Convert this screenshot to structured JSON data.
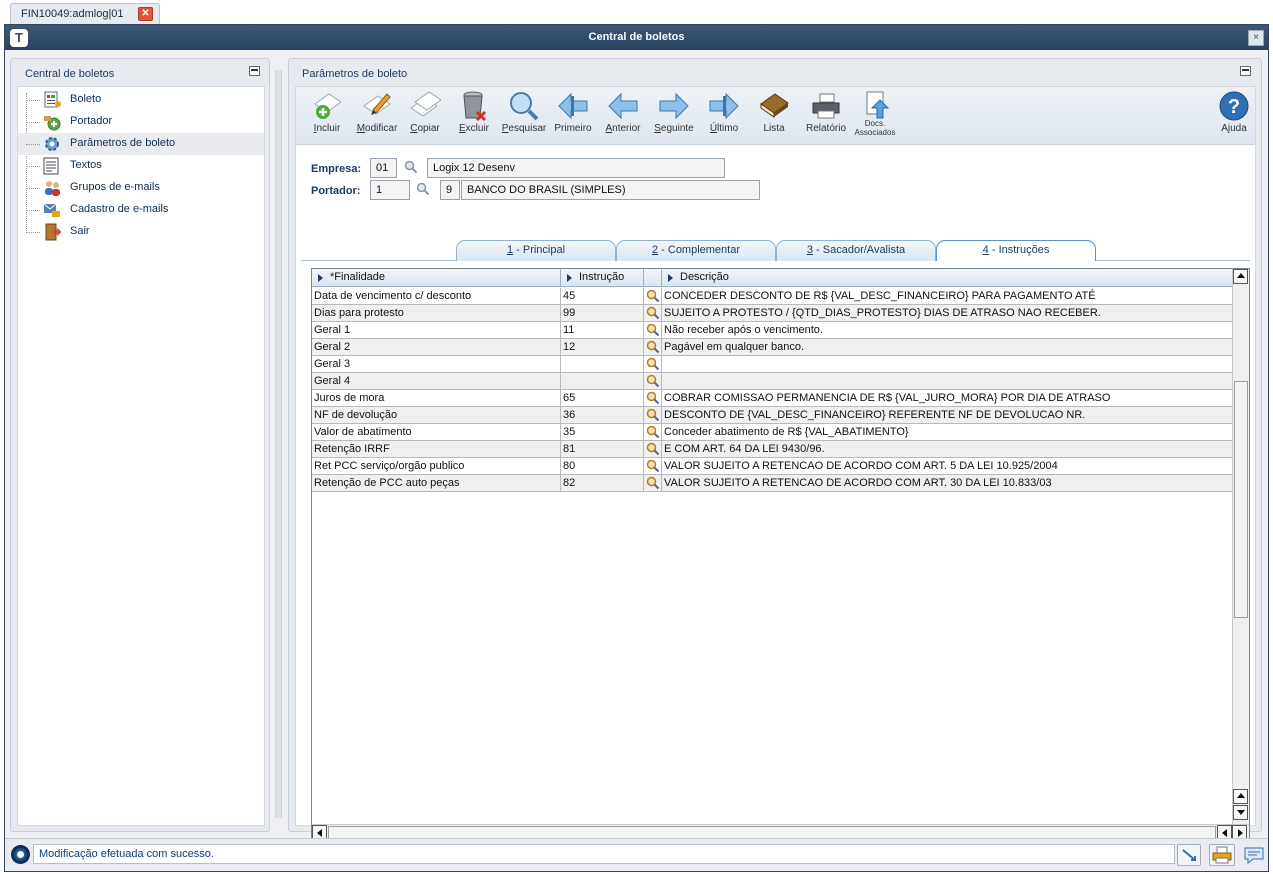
{
  "tab": {
    "label": "FIN10049:admlog|01",
    "close": "✕"
  },
  "window": {
    "title": "Central de boletos",
    "logo": "T",
    "close": "×"
  },
  "left_panel": {
    "title": "Central de boletos",
    "items": [
      {
        "label": "Boleto",
        "icon": "boleto-icon"
      },
      {
        "label": "Portador",
        "icon": "portador-icon"
      },
      {
        "label": "Parâmetros de boleto",
        "icon": "gear-icon"
      },
      {
        "label": "Textos",
        "icon": "text-document-icon"
      },
      {
        "label": "Grupos de e-mails",
        "icon": "users-group-icon"
      },
      {
        "label": "Cadastro de e-mails",
        "icon": "email-register-icon"
      },
      {
        "label": "Sair",
        "icon": "exit-door-icon"
      }
    ]
  },
  "right_panel": {
    "title": "Parâmetros de boleto",
    "toolbar": {
      "incluir": "Incluir",
      "modificar": "Modificar",
      "copiar": "Copiar",
      "excluir": "Excluir",
      "pesquisar": "Pesquisar",
      "primeiro": "Primeiro",
      "anterior": "Anterior",
      "seguinte": "Seguinte",
      "ultimo": "Último",
      "lista": "Lista",
      "relatorio": "Relatório",
      "docs_line1": "Docs.",
      "docs_line2": "Associados",
      "ajuda": "Ajuda"
    },
    "form": {
      "empresa_label": "Empresa:",
      "empresa_code": "01",
      "empresa_name": "Logix 12 Desenv",
      "portador_label": "Portador:",
      "portador_code": "1",
      "portador_sub": "9",
      "portador_name": "BANCO DO BRASIL (SIMPLES)"
    },
    "tabs": [
      {
        "key": "1",
        "label": " - Principal"
      },
      {
        "key": "2",
        "label": " - Complementar"
      },
      {
        "key": "3",
        "label": " - Sacador/Avalista"
      },
      {
        "key": "4",
        "label": " - Instruções"
      }
    ],
    "active_tab": 3,
    "grid": {
      "headers": {
        "finalidade": "*Finalidade",
        "instrucao": "Instrução",
        "descricao": "Descrição"
      },
      "rows": [
        {
          "finalidade": "Data de vencimento c/ desconto",
          "instrucao": "45",
          "descricao": "CONCEDER DESCONTO DE R$ {VAL_DESC_FINANCEIRO} PARA PAGAMENTO ATÉ"
        },
        {
          "finalidade": "Dias para protesto",
          "instrucao": "99",
          "descricao": "SUJEITO A PROTESTO / {QTD_DIAS_PROTESTO} DIAS DE ATRASO NAO RECEBER."
        },
        {
          "finalidade": "Geral 1",
          "instrucao": "11",
          "descricao": "Não receber após o vencimento."
        },
        {
          "finalidade": "Geral 2",
          "instrucao": "12",
          "descricao": "Pagável em qualquer banco."
        },
        {
          "finalidade": "Geral 3",
          "instrucao": "",
          "descricao": ""
        },
        {
          "finalidade": "Geral 4",
          "instrucao": "",
          "descricao": ""
        },
        {
          "finalidade": "Juros de mora",
          "instrucao": "65",
          "descricao": "COBRAR COMISSAO PERMANENCIA DE R$ {VAL_JURO_MORA} POR DIA DE ATRASO"
        },
        {
          "finalidade": "NF de devolução",
          "instrucao": "36",
          "descricao": "DESCONTO DE {VAL_DESC_FINANCEIRO} REFERENTE NF DE DEVOLUCAO NR."
        },
        {
          "finalidade": "Valor de abatimento",
          "instrucao": "35",
          "descricao": "Conceder abatimento de R$ {VAL_ABATIMENTO}"
        },
        {
          "finalidade": "Retenção IRRF",
          "instrucao": "81",
          "descricao": "E COM ART. 64 DA LEI 9430/96."
        },
        {
          "finalidade": "Ret PCC serviço/orgão publico",
          "instrucao": "80",
          "descricao": "VALOR SUJEITO A RETENCAO DE ACORDO COM ART. 5 DA LEI 10.925/2004"
        },
        {
          "finalidade": "Retenção de PCC auto peças",
          "instrucao": "82",
          "descricao": "VALOR SUJEITO A RETENCAO DE ACORDO COM ART. 30 DA LEI 10.833/03"
        }
      ]
    }
  },
  "status": {
    "message": "Modificação efetuada com sucesso."
  },
  "colors": {
    "titlebar": "#2f4a6c",
    "accent": "#2f6fb4",
    "status_text": "#12397a"
  }
}
